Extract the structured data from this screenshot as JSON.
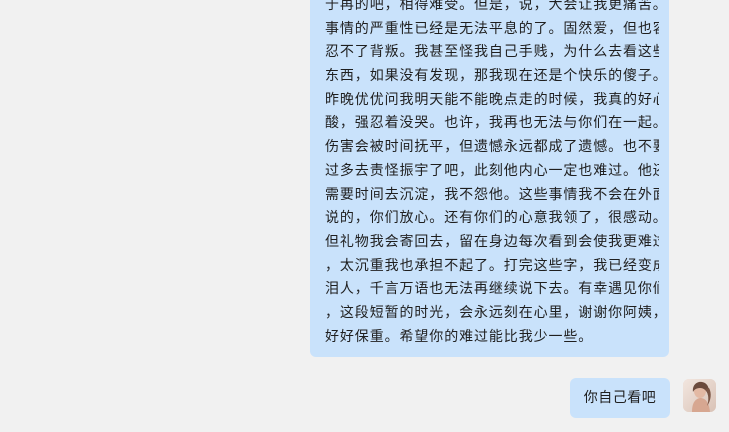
{
  "messages": [
    {
      "sender": "other",
      "lines": [
        "于再的吧，相得难受。但是，说，大会让我更痛苦。",
        "事情的严重性已经是无法平息的了。固然爱，但也容",
        "忍不了背叛。我甚至怪我自己手贱，为什么去看这些",
        "东西，如果没有发现，那我现在还是个快乐的傻子。",
        "昨晚优优问我明天能不能晚点走的时候，我真的好心",
        "酸，强忍着没哭。也许，我再也无法与你们在一起。",
        "伤害会被时间抚平，但遗憾永远都成了遗憾。也不要",
        "过多去责怪振宇了吧，此刻他内心一定也难过。他还",
        "需要时间去沉淀，我不怨他。这些事情我不会在外面",
        "说的，你们放心。还有你们的心意我领了，很感动。",
        "但礼物我会寄回去，留在身边每次看到会使我更难过",
        "，太沉重我也承担不起了。打完这些字，我已经变成",
        "泪人，千言万语也无法再继续说下去。有幸遇见你们",
        "，这段短暂的时光，会永远刻在心里，谢谢你阿姨，",
        "好好保重。希望你的难过能比我少一些。"
      ]
    },
    {
      "sender": "me",
      "text": "你自己看吧",
      "avatar": "user-avatar-photo"
    }
  ],
  "colors": {
    "background": "#f1f1f1",
    "bubble": "#c9e2fb",
    "text": "#1f1f1f"
  }
}
